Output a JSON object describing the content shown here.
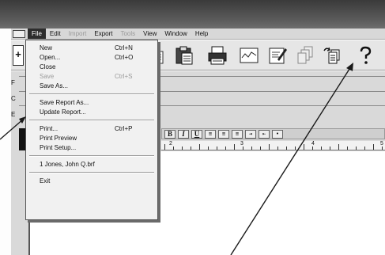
{
  "menubar": {
    "items": [
      {
        "label": "File",
        "state": "active"
      },
      {
        "label": "Edit",
        "state": "normal"
      },
      {
        "label": "Import",
        "state": "disabled"
      },
      {
        "label": "Export",
        "state": "normal"
      },
      {
        "label": "Tools",
        "state": "disabled"
      },
      {
        "label": "View",
        "state": "normal"
      },
      {
        "label": "Window",
        "state": "normal"
      },
      {
        "label": "Help",
        "state": "normal"
      }
    ]
  },
  "toolbar": {
    "plus_label": "+",
    "icons": [
      "copy-icon",
      "paste-icon",
      "print-icon",
      "chart-icon",
      "edit-report-icon",
      "stack-icon",
      "update-report-icon",
      "help-icon"
    ]
  },
  "side_tabs": [
    "F",
    "C",
    "E"
  ],
  "format_bar": {
    "bold": "B",
    "italic": "I",
    "underline": "U"
  },
  "ruler": {
    "numbers": [
      "2",
      "3",
      "4",
      "5"
    ]
  },
  "file_menu": {
    "groups": [
      [
        {
          "label": "New",
          "shortcut": "Ctrl+N",
          "disabled": false
        },
        {
          "label": "Open...",
          "shortcut": "Ctrl+O",
          "disabled": false
        },
        {
          "label": "Close",
          "shortcut": "",
          "disabled": false
        },
        {
          "label": "Save",
          "shortcut": "Ctrl+S",
          "disabled": true
        },
        {
          "label": "Save As...",
          "shortcut": "",
          "disabled": false
        }
      ],
      [
        {
          "label": "Save Report As...",
          "shortcut": "",
          "disabled": false
        },
        {
          "label": "Update Report...",
          "shortcut": "",
          "disabled": false
        }
      ],
      [
        {
          "label": "Print...",
          "shortcut": "Ctrl+P",
          "disabled": false
        },
        {
          "label": "Print Preview",
          "shortcut": "",
          "disabled": false
        },
        {
          "label": "Print Setup...",
          "shortcut": "",
          "disabled": false
        }
      ],
      [
        {
          "label": "1 Jones, John Q.brf",
          "shortcut": "",
          "disabled": false
        }
      ],
      [
        {
          "label": "Exit",
          "shortcut": "",
          "disabled": false
        }
      ]
    ]
  },
  "colors": {
    "menu_active_bg": "#2d2d2d",
    "disabled_text": "#9a9a9a",
    "callout_line": "#1a1a1a"
  }
}
